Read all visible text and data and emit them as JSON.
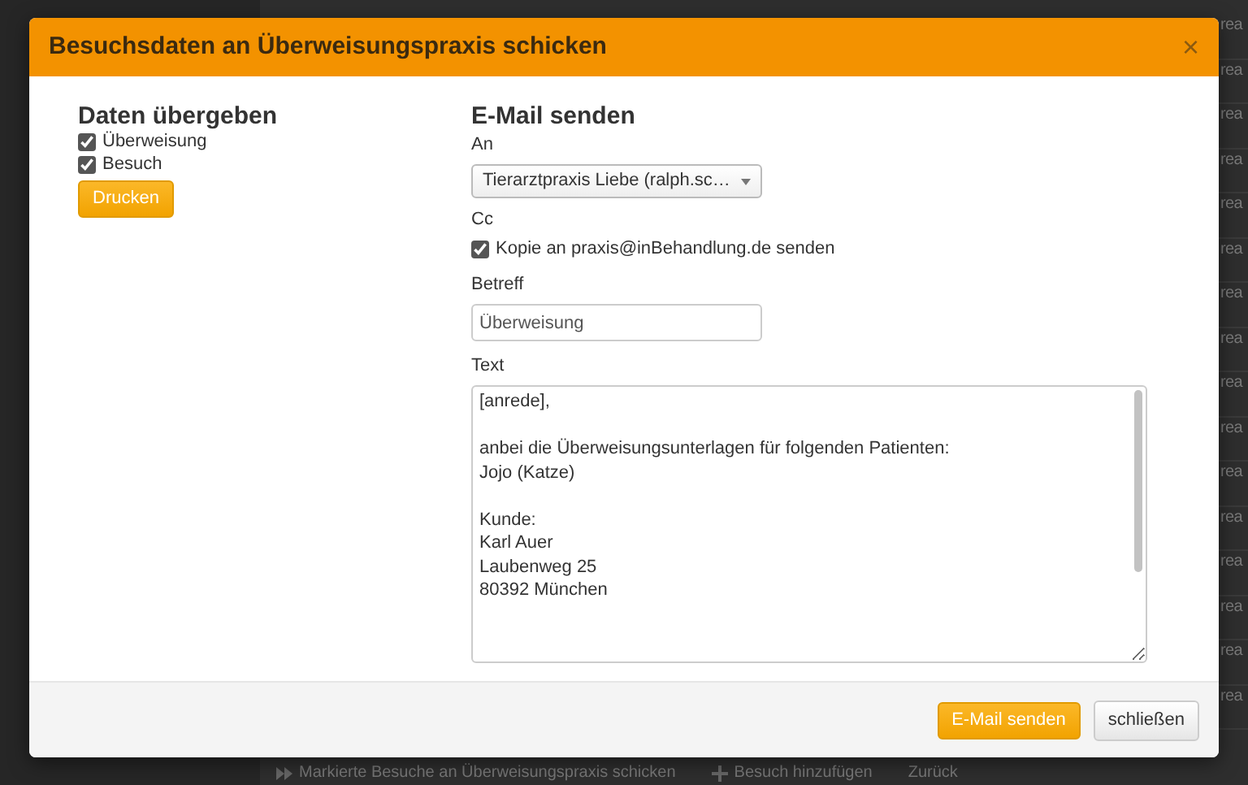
{
  "background": {
    "list_items": [
      "rea",
      "rea",
      "rea",
      "rea",
      "rea",
      "rea",
      "rea",
      "rea",
      "rea",
      "rea",
      "rea",
      "rea",
      "rea",
      "rea",
      "rea",
      "rea"
    ],
    "toolbar": [
      {
        "kind": "forward",
        "label": "Markierte Besuche an Überweisungspraxis schicken"
      },
      {
        "kind": "plus",
        "label": "Besuch hinzufügen"
      },
      {
        "kind": "plain",
        "label": "Zurück"
      }
    ]
  },
  "dialog": {
    "title": "Besuchsdaten an Überweisungspraxis schicken",
    "close": "×",
    "left": {
      "heading": "Daten übergeben",
      "options": [
        {
          "label": "Überweisung",
          "checked": true
        },
        {
          "label": "Besuch",
          "checked": true
        }
      ],
      "print_button": "Drucken"
    },
    "right": {
      "heading": "E-Mail senden",
      "to_label": "An",
      "to_value": "Tierarztpraxis Liebe (ralph.sc…",
      "cc_label": "Cc",
      "cc_option": {
        "label": "Kopie an praxis@inBehandlung.de senden",
        "checked": true
      },
      "subject_label": "Betreff",
      "subject_value": "Überweisung",
      "text_label": "Text",
      "text_value": "[anrede],\n\nanbei die Überweisungsunterlagen für folgenden Patienten:\nJojo (Katze)\n\nKunde:\nKarl Auer\nLaubenweg 25\n80392 München"
    },
    "buttons": [
      {
        "kind": "primary",
        "label": "E-Mail senden"
      },
      {
        "kind": "secondary",
        "label": "schließen"
      }
    ]
  }
}
